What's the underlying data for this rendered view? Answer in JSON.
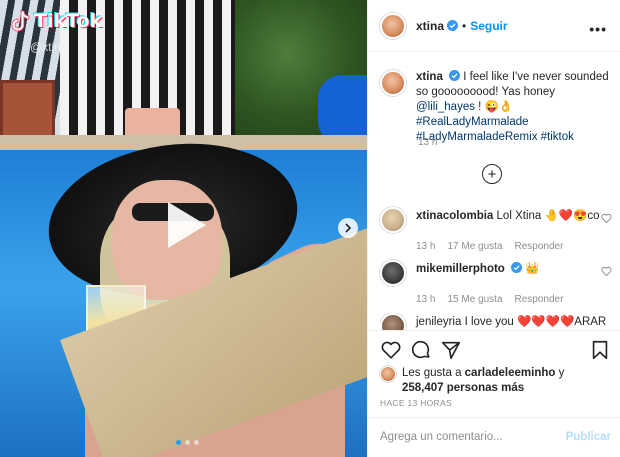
{
  "media": {
    "tiktok_brand": "TikTok",
    "tiktok_handle": "@xtina",
    "carousel_total": 3,
    "carousel_active": 1
  },
  "header": {
    "username": "xtina",
    "separator": "•",
    "follow_label": "Seguir",
    "more_label": "•••"
  },
  "caption": {
    "username": "xtina",
    "text_1": "I feel like I've never sounded so gooooooood! Yas honey ",
    "mention": "@lili_hayes",
    "text_2": " ! 😜👌 ",
    "hashtag_1": "#RealLadyMarmalade",
    "hashtag_2": "#LadyMarmaladeRemix",
    "hashtag_3": "#tiktok",
    "time": "13 h"
  },
  "comments": [
    {
      "username": "xtinacolombia",
      "text": "Lol Xtina 🤚❤️😍co",
      "time": "13 h",
      "likes": "17 Me gusta",
      "reply": "Responder",
      "avatar_color": "#c9b08a"
    },
    {
      "username": "mikemillerphoto",
      "text": "👑",
      "time": "13 h",
      "likes": "15 Me gusta",
      "reply": "Responder",
      "avatar_color": "#3c3c3c"
    },
    {
      "username": "jenileyria",
      "text": "I love you ❤️❤️❤️❤️ARAR",
      "time": "",
      "likes": "",
      "reply": "",
      "avatar_color": "#7a5c4a"
    }
  ],
  "likes": {
    "prefix": "Les gusta a ",
    "user": "carladeleeminho",
    "middle": " y",
    "count": "258,407 personas más"
  },
  "post_time": "HACE 13 HORAS",
  "comment_bar": {
    "placeholder": "Agrega un comentario...",
    "publish_label": "Publicar"
  },
  "colors": {
    "accent": "#0095f6",
    "publish_disabled": "#b2dffc",
    "link": "#00376b",
    "muted": "#8e8e8e"
  }
}
